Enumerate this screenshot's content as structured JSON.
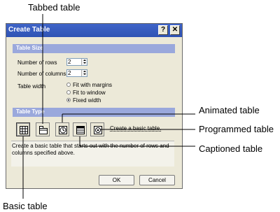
{
  "callouts": {
    "tabbed": "Tabbed table",
    "animated": "Animated table",
    "programmed": "Programmed table",
    "captioned": "Captioned table",
    "basic": "Basic table"
  },
  "dialog": {
    "title": "Create Table",
    "help_button": "?",
    "close_button": "✕",
    "table_size": {
      "header": "Table Size",
      "rows_label": "Number of rows",
      "rows_value": "2",
      "columns_label": "Number of columns",
      "columns_value": "2",
      "width_label": "Table width",
      "width_options": [
        "Fit with margins",
        "Fit to window",
        "Fixed width"
      ],
      "width_selected": "Fixed width"
    },
    "table_type": {
      "header": "Table Type",
      "icons": [
        "basic-table-icon",
        "tabbed-table-icon",
        "animated-table-icon",
        "captioned-table-icon",
        "programmed-table-icon"
      ],
      "selected_label": "Create a basic table.",
      "description": "Create a basic table that starts out with the number of rows and columns specified above."
    },
    "ok_button": "OK",
    "cancel_button": "Cancel"
  }
}
